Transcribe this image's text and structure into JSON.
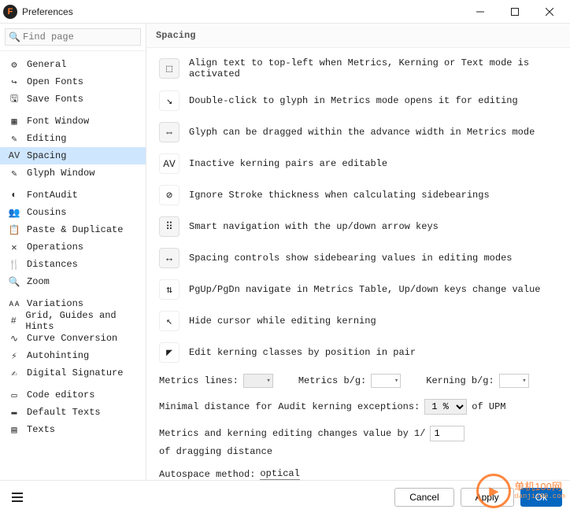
{
  "window": {
    "title": "Preferences"
  },
  "search": {
    "placeholder": "Find page"
  },
  "sidebar": {
    "groups": [
      {
        "items": [
          {
            "icon": "⚙",
            "label": "General"
          },
          {
            "icon": "↪",
            "label": "Open Fonts"
          },
          {
            "icon": "🖫",
            "label": "Save Fonts"
          }
        ]
      },
      {
        "items": [
          {
            "icon": "▦",
            "label": "Font Window"
          },
          {
            "icon": "✎",
            "label": "Editing"
          },
          {
            "icon": "AV",
            "label": "Spacing",
            "selected": true
          },
          {
            "icon": "✎",
            "label": "Glyph Window"
          }
        ]
      },
      {
        "items": [
          {
            "icon": "◐",
            "label": "FontAudit"
          },
          {
            "icon": "👥",
            "label": "Cousins"
          },
          {
            "icon": "📋",
            "label": "Paste & Duplicate"
          },
          {
            "icon": "✕",
            "label": "Operations"
          },
          {
            "icon": "🍴",
            "label": "Distances"
          },
          {
            "icon": "🔍",
            "label": "Zoom"
          }
        ]
      },
      {
        "items": [
          {
            "icon": "ᴀᴀ",
            "label": "Variations"
          },
          {
            "icon": "#",
            "label": "Grid, Guides and Hints"
          },
          {
            "icon": "∿",
            "label": "Curve Conversion"
          },
          {
            "icon": "⚡",
            "label": "Autohinting"
          },
          {
            "icon": "✍",
            "label": "Digital Signature"
          }
        ]
      },
      {
        "items": [
          {
            "icon": "▭",
            "label": "Code editors"
          },
          {
            "icon": "▬",
            "label": "Default Texts"
          },
          {
            "icon": "▤",
            "label": "Texts"
          }
        ]
      }
    ]
  },
  "section": {
    "title": "Spacing"
  },
  "options": [
    {
      "icon": "⬚",
      "on": true,
      "label": "Align text to top-left when Metrics, Kerning or Text mode is activated"
    },
    {
      "icon": "↘",
      "on": false,
      "label": "Double-click to glyph in Metrics mode opens it for editing"
    },
    {
      "icon": "⇔",
      "on": true,
      "label": "Glyph can be dragged within the advance width in Metrics mode"
    },
    {
      "icon": "AV",
      "on": false,
      "label": "Inactive kerning pairs are editable"
    },
    {
      "icon": "⊘",
      "on": false,
      "label": "Ignore Stroke thickness when calculating sidebearings"
    },
    {
      "icon": "⠿",
      "on": true,
      "label": "Smart navigation with the up/down arrow keys"
    },
    {
      "icon": "↔",
      "on": true,
      "label": "Spacing controls show sidebearing values in editing modes"
    },
    {
      "icon": "⇅",
      "on": false,
      "label": "PgUp/PgDn navigate in Metrics Table, Up/down keys change value"
    },
    {
      "icon": "↖",
      "on": false,
      "label": "Hide cursor while editing kerning"
    },
    {
      "icon": "◤",
      "on": false,
      "label": "Edit kerning classes by position in pair"
    }
  ],
  "form": {
    "metrics_lines_label": "Metrics lines:",
    "metrics_bg_label": "Metrics b/g:",
    "kerning_bg_label": "Kerning b/g:",
    "min_dist_label": "Minimal distance for Audit kerning exceptions:",
    "min_dist_value": "1 %",
    "min_dist_suffix": "of UPM",
    "drag_label_pre": "Metrics and kerning editing changes value by 1/",
    "drag_value": "1",
    "drag_label_post": "of dragging distance",
    "autospace_label": "Autospace method:",
    "autospace_value": "optical"
  },
  "footer": {
    "cancel": "Cancel",
    "apply": "Apply",
    "ok": "Ok"
  },
  "watermark": {
    "brand": "单机100网",
    "url": "danji100.com"
  }
}
